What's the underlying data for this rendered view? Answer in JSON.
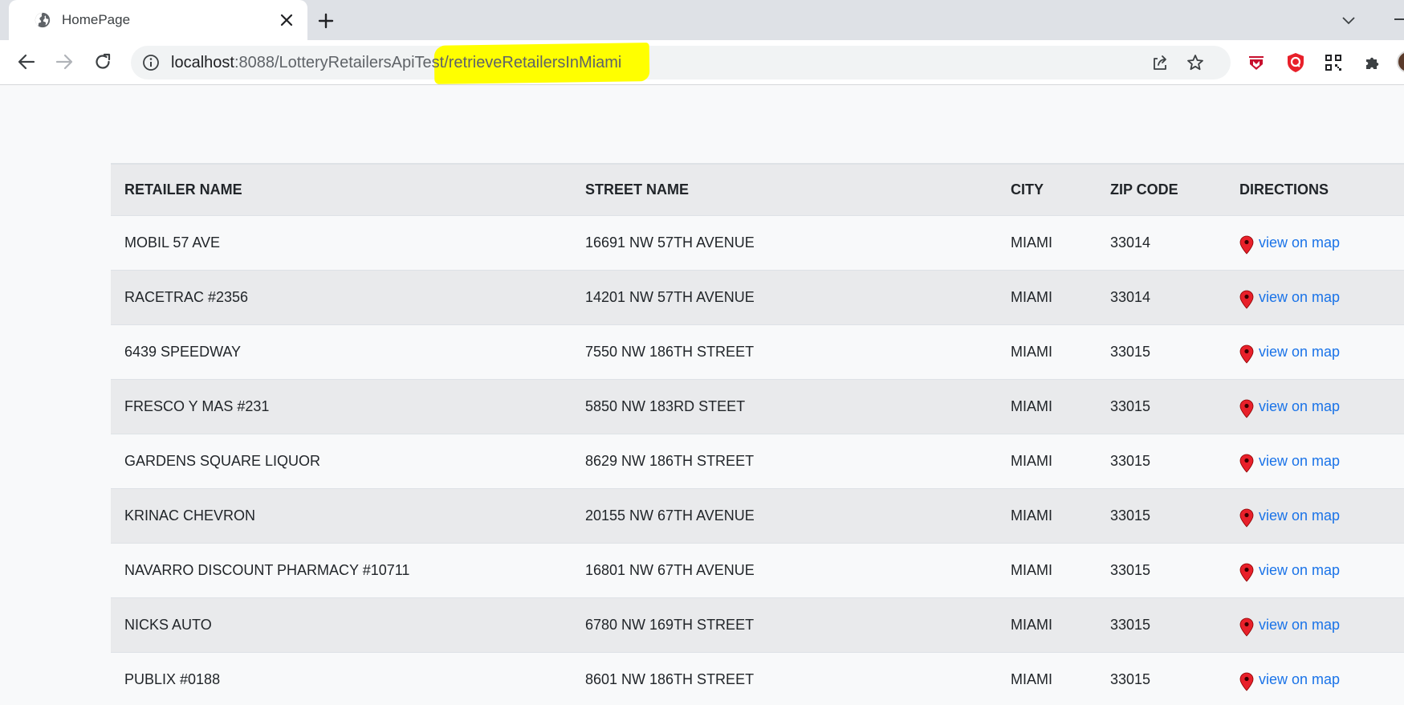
{
  "browser": {
    "tab_title": "HomePage",
    "url_host": "localhost",
    "url_rest": ":8088/LotteryRetailersApiTest/retrieveRetailersInMiami",
    "highlight_color": "#ffff00"
  },
  "table": {
    "headers": [
      "RETAILER NAME",
      "STREET NAME",
      "CITY",
      "ZIP CODE",
      "DIRECTIONS"
    ],
    "rows": [
      {
        "name": "MOBIL 57 AVE",
        "street": "16691 NW 57TH AVENUE",
        "city": "MIAMI",
        "zip": "33014",
        "link": "view on map"
      },
      {
        "name": "RACETRAC #2356",
        "street": "14201 NW 57TH AVENUE",
        "city": "MIAMI",
        "zip": "33014",
        "link": "view on map"
      },
      {
        "name": "6439 SPEEDWAY",
        "street": "7550 NW 186TH STREET",
        "city": "MIAMI",
        "zip": "33015",
        "link": "view on map"
      },
      {
        "name": "FRESCO Y MAS #231",
        "street": "5850 NW 183RD STEET",
        "city": "MIAMI",
        "zip": "33015",
        "link": "view on map"
      },
      {
        "name": "GARDENS SQUARE LIQUOR",
        "street": "8629 NW 186TH STREET",
        "city": "MIAMI",
        "zip": "33015",
        "link": "view on map"
      },
      {
        "name": "KRINAC CHEVRON",
        "street": "20155 NW 67TH AVENUE",
        "city": "MIAMI",
        "zip": "33015",
        "link": "view on map"
      },
      {
        "name": "NAVARRO DISCOUNT PHARMACY #10711",
        "street": "16801 NW 67TH AVENUE",
        "city": "MIAMI",
        "zip": "33015",
        "link": "view on map"
      },
      {
        "name": "NICKS AUTO",
        "street": "6780 NW 169TH STREET",
        "city": "MIAMI",
        "zip": "33015",
        "link": "view on map"
      },
      {
        "name": "PUBLIX #0188",
        "street": "8601 NW 186TH STREET",
        "city": "MIAMI",
        "zip": "33015",
        "link": "view on map"
      }
    ]
  },
  "colors": {
    "link": "#1a73e8",
    "pin": "#e8202a"
  },
  "icons": [
    "globe-icon",
    "close-icon",
    "plus-icon",
    "chevron-down-icon",
    "back-arrow-icon",
    "forward-arrow-icon",
    "reload-icon",
    "info-icon",
    "share-icon",
    "star-icon",
    "map-pin-icon"
  ]
}
